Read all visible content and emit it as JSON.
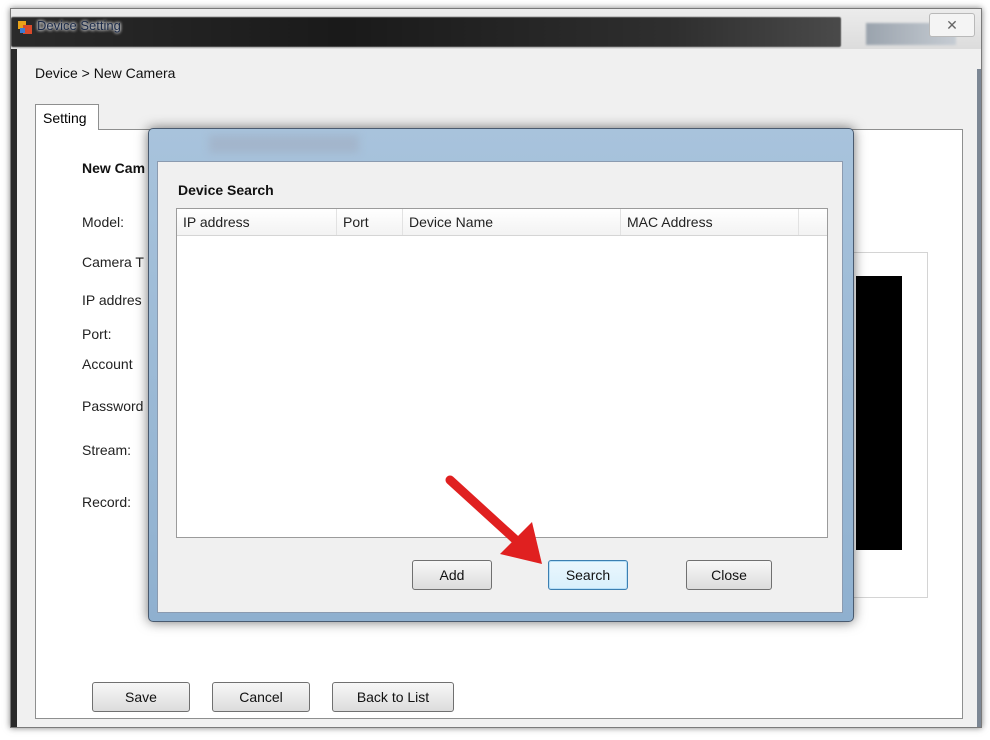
{
  "window": {
    "title": "Device Setting",
    "close_glyph": "✕"
  },
  "breadcrumb": "Device > New Camera",
  "tabs": [
    {
      "label": "Setting"
    }
  ],
  "form": {
    "heading": "New Cam",
    "labels": [
      "Model:",
      "Camera T",
      "IP addres",
      "Port:",
      "Account",
      "Password",
      "Stream:",
      "Record:"
    ]
  },
  "footer_buttons": {
    "save": "Save",
    "cancel": "Cancel",
    "back": "Back to List"
  },
  "dialog": {
    "title": "Device Search",
    "columns": [
      "IP address",
      "Port",
      "Device Name",
      "MAC Address"
    ],
    "rows": [],
    "buttons": {
      "add": "Add",
      "search": "Search",
      "close": "Close"
    }
  },
  "colors": {
    "arrow": "#e02020",
    "dialog_frame": "#9bb8d6"
  },
  "icons": {
    "app": "app-icon",
    "close": "close-icon",
    "arrow": "red-arrow-icon"
  }
}
